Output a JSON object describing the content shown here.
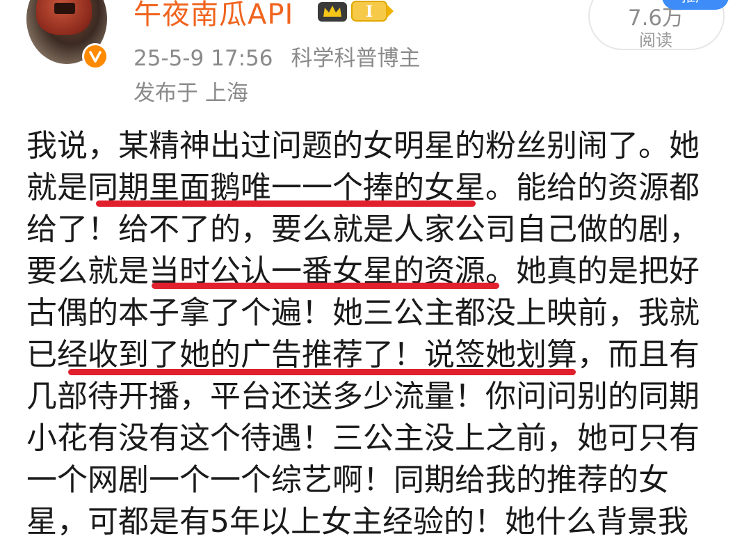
{
  "user": {
    "name": "午夜南瓜API",
    "level": "I",
    "timestamp": "25-5-9 17:56",
    "title": "科学科普博主",
    "location": "发布于 上海"
  },
  "stats": {
    "reads_count": "7.6万",
    "reads_label": "阅读",
    "pin_tag": "推广"
  },
  "colors": {
    "username": "#f0641e",
    "meta": "#8a8a8a",
    "underline": "#e0202c",
    "verify_badge": "#ff8a00"
  },
  "icons": [
    "avatar-image",
    "verified-icon",
    "crown-badge-icon",
    "level-badge-icon"
  ],
  "post": {
    "lines": [
      "我说，某精神出过问题的女明星的粉丝别闹了。她",
      "就是同期里面鹅唯一一个捧的女星。能给的资源都",
      "给了！给不了的，要么就是人家公司自己做的剧，",
      "要么就是当时公认一番女星的资源。她真的是把好",
      "古偶的本子拿了个遍！她三公主都没上映前，我就",
      "已经收到了她的广告推荐了！说签她划算，而且有",
      "几部待开播，平台还送多少流量！你问问别的同期",
      "小花有没有这个待遇！三公主没上之前，她可只有",
      "一个网剧一个一个综艺啊！同期给我的推荐的女",
      "星，可都是有5年以上女主经验的！她什么背景我"
    ],
    "highlights": [
      "同期里面鹅唯一一个捧的女星",
      "当时公认一番女星的资源",
      "经收到了她的广告推荐了！说签她划算"
    ]
  }
}
